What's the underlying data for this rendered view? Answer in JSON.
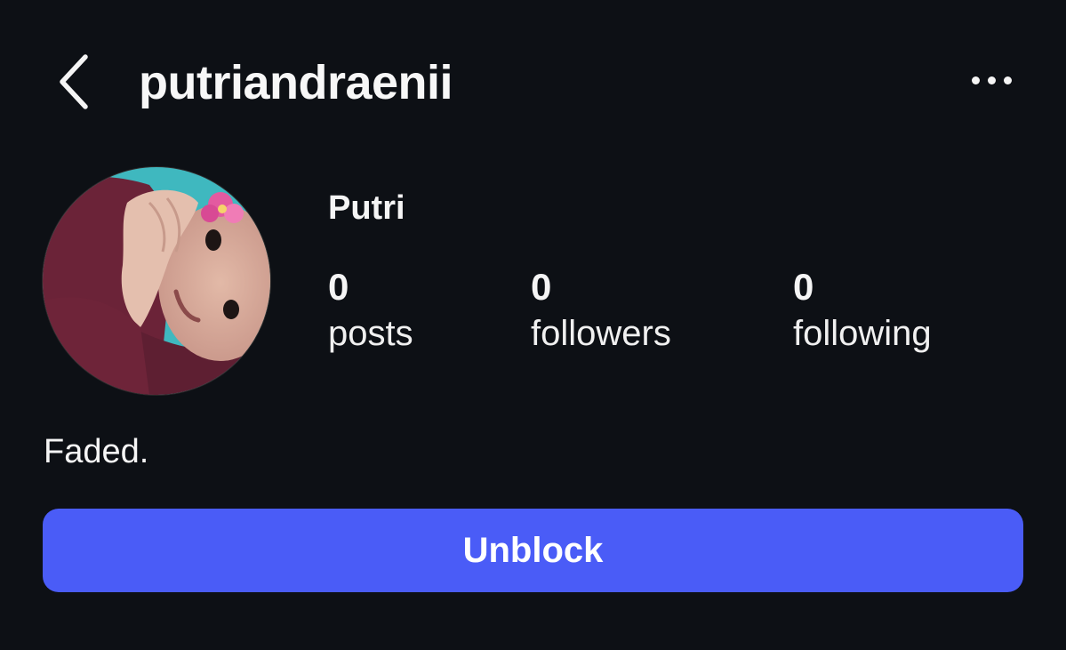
{
  "header": {
    "username": "putriandraenii",
    "back_icon": "chevron-left-icon",
    "more_icon": "more-horizontal-icon"
  },
  "profile": {
    "display_name": "Putri",
    "bio": "Faded.",
    "avatar_icon": "profile-photo",
    "stats": {
      "posts": {
        "count": "0",
        "label": "posts"
      },
      "followers": {
        "count": "0",
        "label": "followers"
      },
      "following": {
        "count": "0",
        "label": "following"
      }
    }
  },
  "actions": {
    "unblock_label": "Unblock"
  },
  "colors": {
    "background": "#0d1015",
    "text": "#f5f5f5",
    "accent_button": "#4a5cf7"
  }
}
